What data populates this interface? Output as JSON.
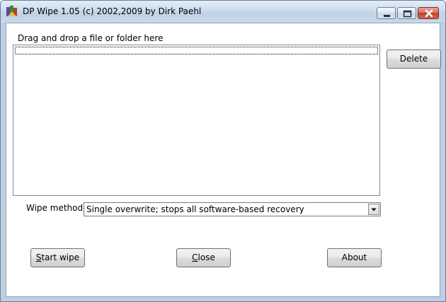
{
  "window": {
    "title": "DP Wipe 1.05 (c) 2002,2009 by Dirk Paehl",
    "app_icon": "app-icon",
    "controls": {
      "minimize_icon": "minimize-icon",
      "maximize_icon": "maximize-icon",
      "close_icon": "close-icon"
    }
  },
  "drop_zone": {
    "label": "Drag and drop a file or folder here",
    "items": []
  },
  "buttons": {
    "delete": "Delete",
    "start_wipe_first": "S",
    "start_wipe_rest": "tart wipe",
    "close_first": "C",
    "close_rest": "lose",
    "about": "About"
  },
  "wipe_method": {
    "label": "Wipe methode:",
    "selected": "Single overwrite; stops all software-based recovery"
  },
  "colors": {
    "titlebar": "#cddcec",
    "frame": "#bcd0e4",
    "close_button": "#c2412a"
  }
}
